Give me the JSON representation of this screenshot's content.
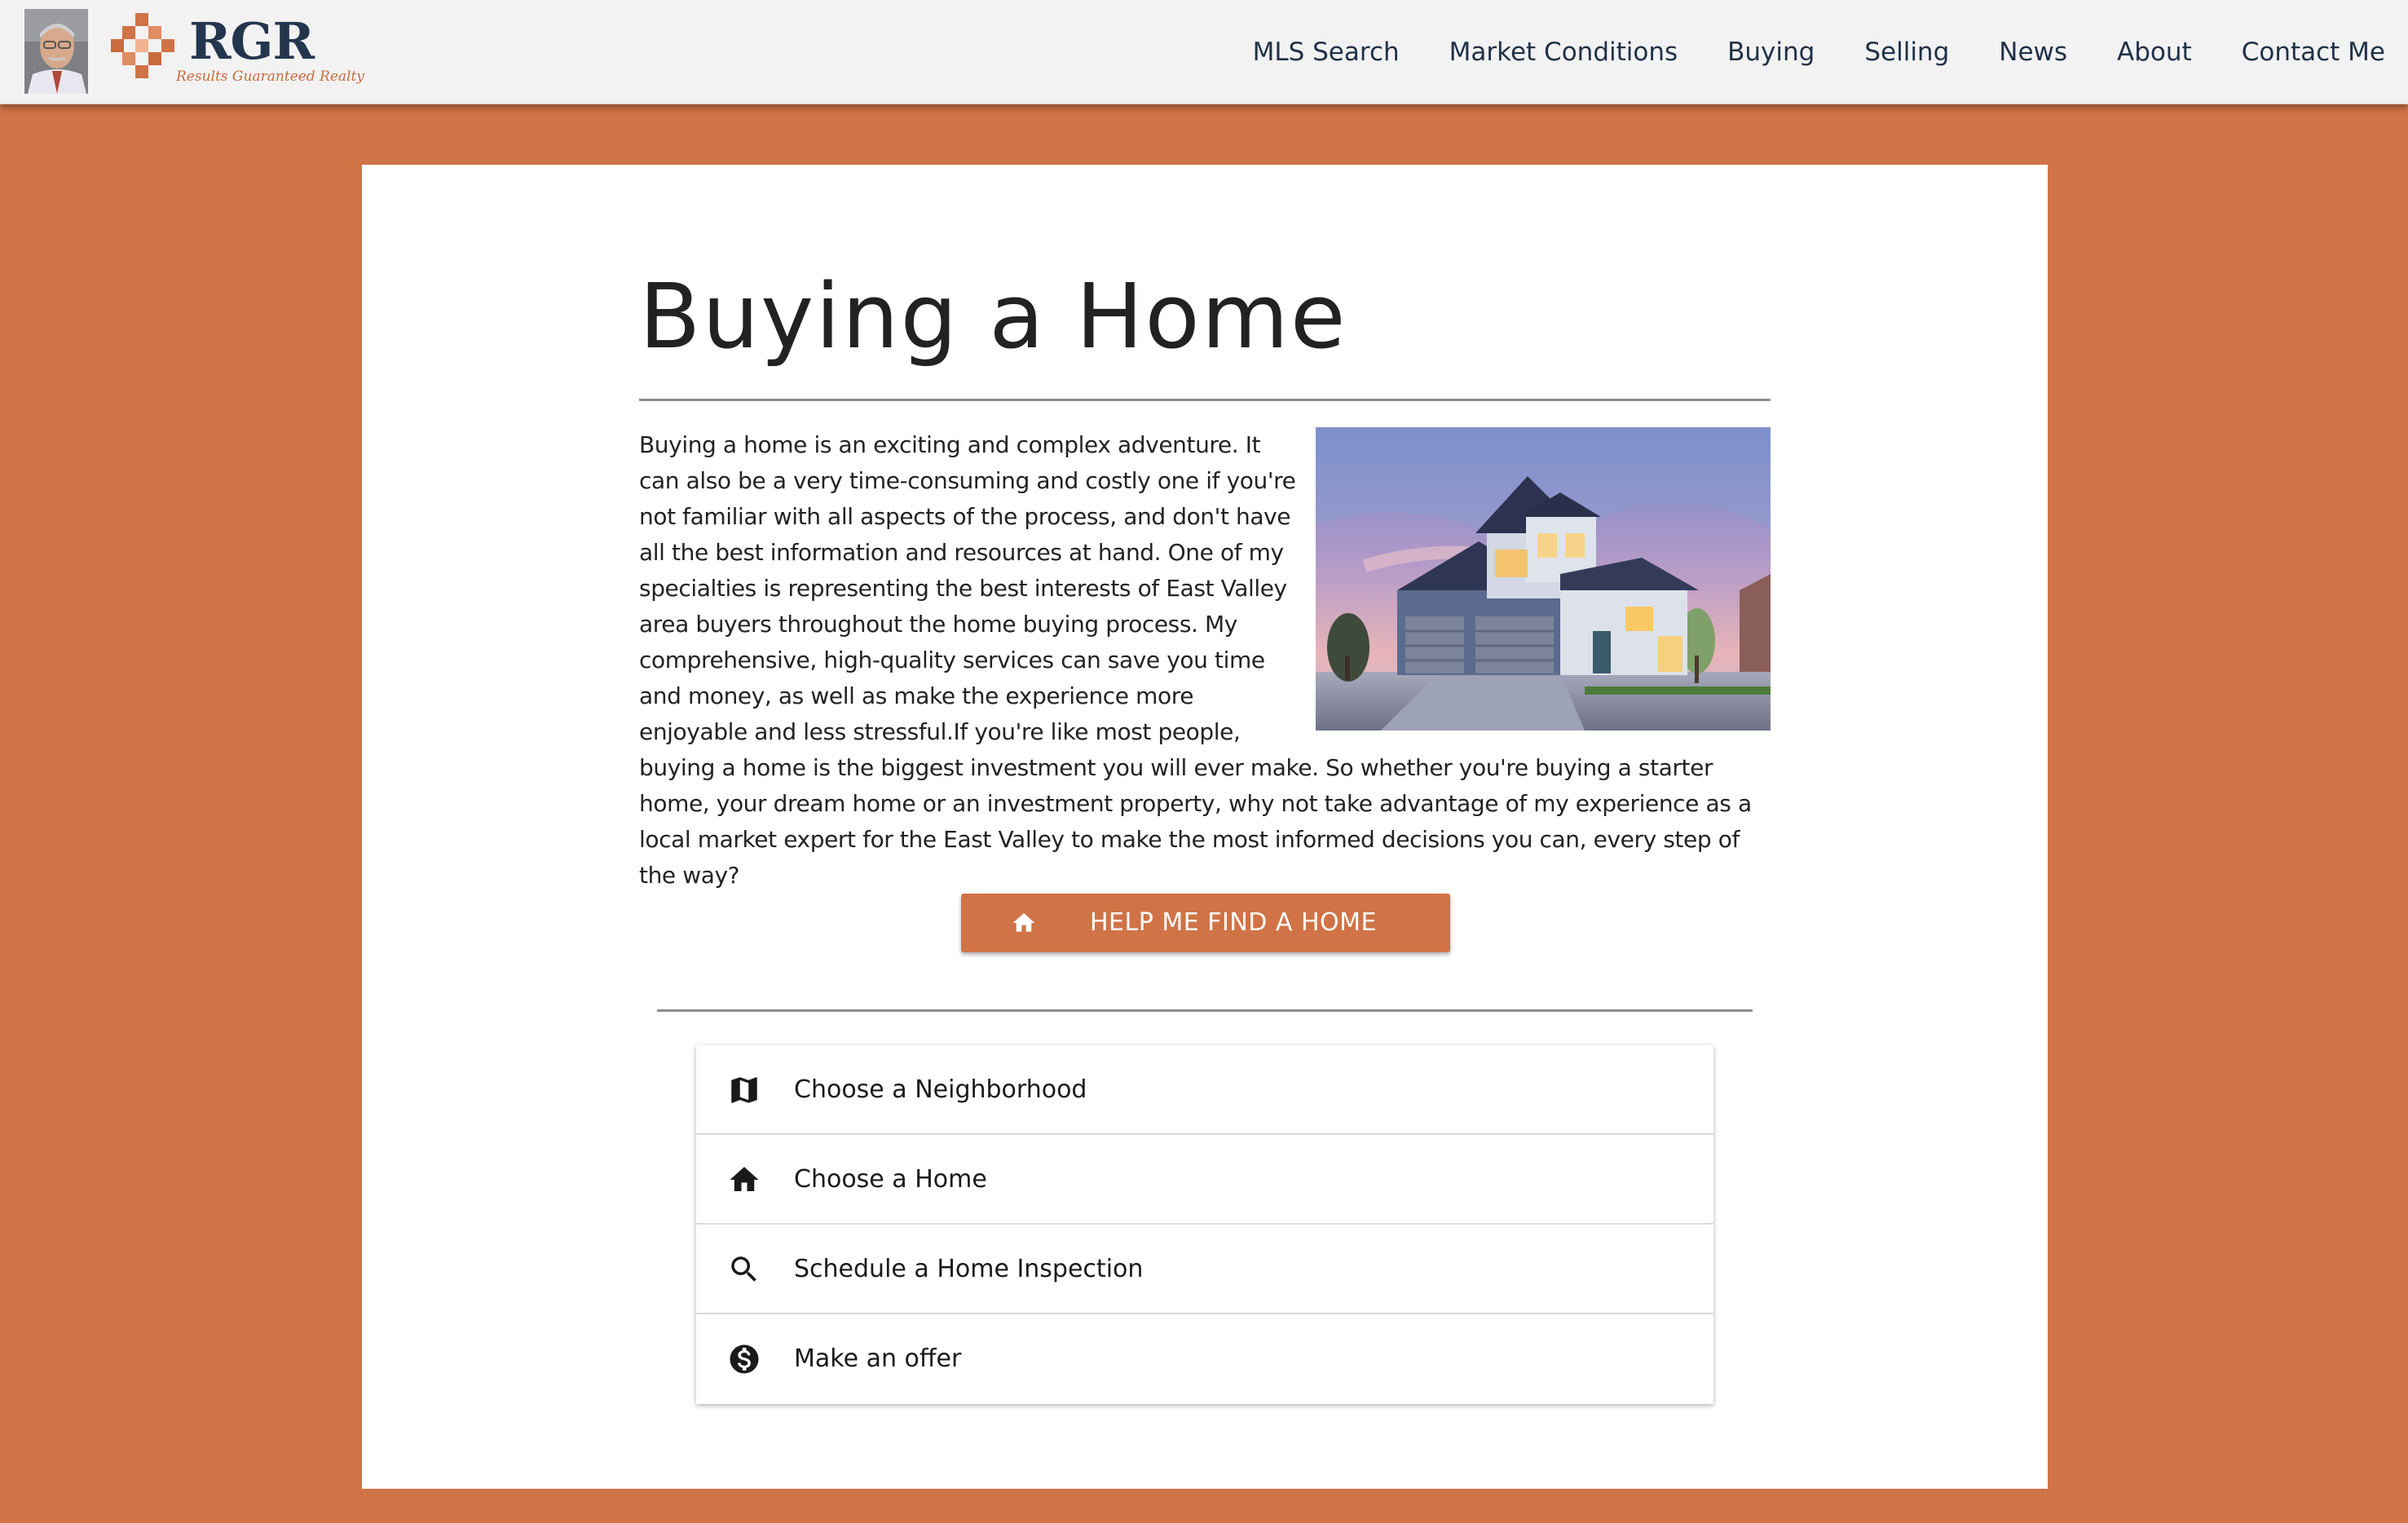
{
  "header": {
    "logo_text": "RGR",
    "logo_tagline": "Results Guaranteed Realty",
    "nav": [
      {
        "label": "MLS Search"
      },
      {
        "label": "Market Conditions"
      },
      {
        "label": "Buying"
      },
      {
        "label": "Selling"
      },
      {
        "label": "News"
      },
      {
        "label": "About"
      },
      {
        "label": "Contact Me"
      }
    ]
  },
  "main": {
    "title": "Buying a Home",
    "paragraph": "Buying a home is an exciting and complex adventure. It can also be a very time-consuming and costly one if you're not familiar with all aspects of the process, and don't have all the best information and resources at hand. One of my specialties is representing the best interests of East Valley area buyers throughout the home buying process. My comprehensive, high-quality services can save you time and money, as well as make the experience more enjoyable and less stressful.If you're like most people, buying a home is the biggest investment you will ever make. So whether you're buying a starter home, your dream home or an investment property, why not take advantage of my experience as a local market expert for the East Valley to make the most informed decisions you can, every step of the way?",
    "cta": {
      "label": "HELP ME FIND A HOME",
      "icon": "home-icon"
    },
    "steps": [
      {
        "label": "Choose a Neighborhood",
        "icon": "map-icon"
      },
      {
        "label": "Choose a Home",
        "icon": "home-icon"
      },
      {
        "label": "Schedule a Home Inspection",
        "icon": "search-icon"
      },
      {
        "label": "Make an offer",
        "icon": "dollar-icon"
      }
    ]
  },
  "colors": {
    "accent": "#d07346",
    "brand_navy": "#24364e",
    "header_bg": "#f2f2f2"
  }
}
